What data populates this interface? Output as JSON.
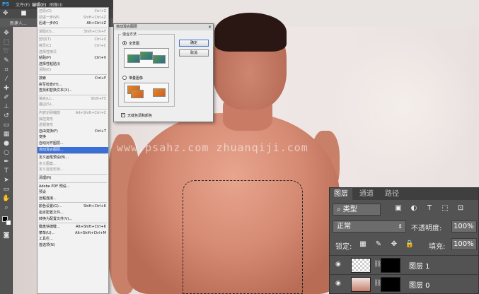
{
  "app": {
    "logo": "PS"
  },
  "menubar": {
    "items": [
      "文件(F)",
      "编辑(E)",
      "图像(I)"
    ]
  },
  "tab": {
    "label": "新建人..."
  },
  "edit_menu": {
    "items": [
      {
        "label": "还原(O)",
        "shortcut": "Ctrl+Z",
        "disabled": true
      },
      {
        "label": "前进一步(W)",
        "shortcut": "Shift+Ctrl+Z",
        "disabled": true
      },
      {
        "label": "后退一步(K)",
        "shortcut": "Alt+Ctrl+Z",
        "disabled": false
      },
      {
        "sep": true
      },
      {
        "label": "渐隐(D)...",
        "shortcut": "Shift+Ctrl+F",
        "disabled": true
      },
      {
        "sep": true
      },
      {
        "label": "剪切(T)",
        "shortcut": "Ctrl+X",
        "disabled": true
      },
      {
        "label": "拷贝(C)",
        "shortcut": "Ctrl+C",
        "disabled": true
      },
      {
        "label": "选择性拷贝",
        "shortcut": "",
        "disabled": true
      },
      {
        "label": "粘贴(P)",
        "shortcut": "Ctrl+V",
        "disabled": false
      },
      {
        "label": "选择性粘贴(I)",
        "shortcut": "",
        "disabled": false
      },
      {
        "label": "清除(E)",
        "shortcut": "",
        "disabled": true
      },
      {
        "sep": true
      },
      {
        "label": "搜索",
        "shortcut": "Ctrl+F",
        "disabled": false
      },
      {
        "label": "拼写检查(H)...",
        "shortcut": "",
        "disabled": false
      },
      {
        "label": "查找和替换文本(X)...",
        "shortcut": "",
        "disabled": false
      },
      {
        "sep": true
      },
      {
        "label": "填充(L)...",
        "shortcut": "Shift+F5",
        "disabled": true
      },
      {
        "label": "描边(S)...",
        "shortcut": "",
        "disabled": true
      },
      {
        "sep": true
      },
      {
        "label": "内容识别缩放",
        "shortcut": "Alt+Shift+Ctrl+C",
        "disabled": true
      },
      {
        "label": "操控变形",
        "shortcut": "",
        "disabled": true
      },
      {
        "label": "透视变形",
        "shortcut": "",
        "disabled": true
      },
      {
        "label": "自由变换(F)",
        "shortcut": "Ctrl+T",
        "disabled": false
      },
      {
        "label": "变换",
        "shortcut": "",
        "disabled": false
      },
      {
        "label": "自动对齐图层...",
        "shortcut": "",
        "disabled": false
      },
      {
        "label": "自动混合图层...",
        "shortcut": "",
        "disabled": false,
        "selected": true
      },
      {
        "sep": true
      },
      {
        "label": "定义画笔预设(B)...",
        "shortcut": "",
        "disabled": false
      },
      {
        "label": "定义图案...",
        "shortcut": "",
        "disabled": true
      },
      {
        "label": "定义自定形状...",
        "shortcut": "",
        "disabled": true
      },
      {
        "sep": true
      },
      {
        "label": "清理(R)",
        "shortcut": "",
        "disabled": false
      },
      {
        "sep": true
      },
      {
        "label": "Adobe PDF 预设...",
        "shortcut": "",
        "disabled": false
      },
      {
        "label": "预设",
        "shortcut": "",
        "disabled": false
      },
      {
        "label": "远程连接...",
        "shortcut": "",
        "disabled": false
      },
      {
        "sep": true
      },
      {
        "label": "颜色设置(G)...",
        "shortcut": "Shift+Ctrl+K",
        "disabled": false
      },
      {
        "label": "指定配置文件...",
        "shortcut": "",
        "disabled": false
      },
      {
        "label": "转换为配置文件(V)...",
        "shortcut": "",
        "disabled": false
      },
      {
        "sep": true
      },
      {
        "label": "键盘快捷键...",
        "shortcut": "Alt+Shift+Ctrl+K",
        "disabled": false
      },
      {
        "label": "菜单(U)...",
        "shortcut": "Alt+Shift+Ctrl+M",
        "disabled": false
      },
      {
        "label": "工具栏...",
        "shortcut": "",
        "disabled": false
      },
      {
        "label": "首选项(N)",
        "shortcut": "",
        "disabled": false
      }
    ]
  },
  "dialog": {
    "title": "自动混合图层",
    "close": "×",
    "group_label": "混合方法",
    "option_panorama": "全景图",
    "option_stack": "堆叠图像",
    "checkbox_label": "无缝色调和颜色",
    "ok": "确定",
    "cancel": "取消"
  },
  "watermark": "www.psahz.com zhuanqiji.com",
  "layers_panel": {
    "tabs": [
      "图层",
      "通道",
      "路径"
    ],
    "filter_kind": "类型",
    "blend_mode": "正常",
    "opacity_label": "不透明度:",
    "opacity_value": "100%",
    "lock_label": "锁定:",
    "fill_label": "填充:",
    "fill_value": "100%",
    "layers": [
      {
        "name": "图层 1"
      },
      {
        "name": "图层 0"
      }
    ]
  }
}
